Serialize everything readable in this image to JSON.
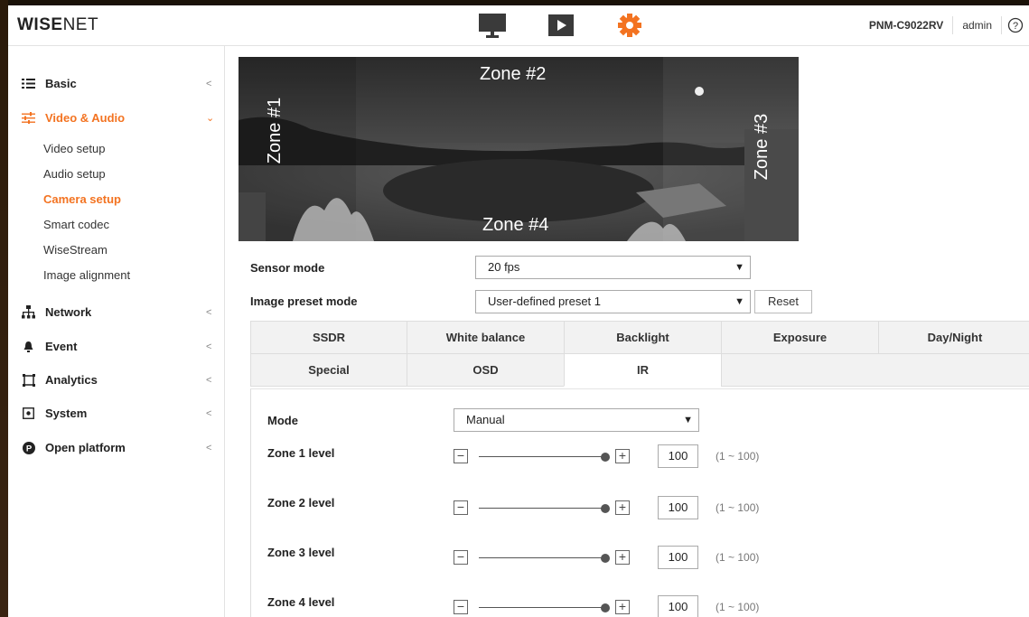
{
  "header": {
    "logo_main": "WISE",
    "logo_tail": "NET",
    "model": "PNM-C9022RV",
    "user": "admin",
    "icons": [
      "monitor-icon",
      "play-icon",
      "gear-icon"
    ],
    "active_color": "#f37321"
  },
  "sidebar": {
    "menus": [
      {
        "label": "Basic",
        "icon": "list-icon"
      },
      {
        "label": "Video & Audio",
        "icon": "sliders-icon"
      },
      {
        "label": "Network",
        "icon": "network-icon"
      },
      {
        "label": "Event",
        "icon": "bell-icon"
      },
      {
        "label": "Analytics",
        "icon": "frame-icon"
      },
      {
        "label": "System",
        "icon": "system-icon"
      },
      {
        "label": "Open platform",
        "icon": "platform-icon"
      }
    ],
    "subitems": [
      "Video setup",
      "Audio setup",
      "Camera setup",
      "Smart codec",
      "WiseStream",
      "Image alignment"
    ],
    "active_menu": "Video & Audio",
    "active_sub": "Camera setup"
  },
  "preview": {
    "zones": [
      "Zone #1",
      "Zone #2",
      "Zone #3",
      "Zone #4"
    ]
  },
  "form": {
    "sensor_mode_label": "Sensor mode",
    "sensor_mode_value": "20 fps",
    "preset_label": "Image preset mode",
    "preset_value": "User-defined preset 1",
    "reset_label": "Reset"
  },
  "tabs": {
    "row1": [
      "SSDR",
      "White balance",
      "Backlight",
      "Exposure",
      "Day/Night"
    ],
    "row2": [
      "Special",
      "OSD",
      "IR"
    ],
    "active": "IR"
  },
  "ir": {
    "mode_label": "Mode",
    "mode_value": "Manual",
    "zones": [
      {
        "label": "Zone 1 level",
        "value": "100",
        "range": "(1 ~ 100)",
        "level": 1.0
      },
      {
        "label": "Zone 2 level",
        "value": "100",
        "range": "(1 ~ 100)",
        "level": 1.0
      },
      {
        "label": "Zone 3 level",
        "value": "100",
        "range": "(1 ~ 100)",
        "level": 1.0
      },
      {
        "label": "Zone 4 level",
        "value": "100",
        "range": "(1 ~ 100)",
        "level": 1.0
      }
    ]
  }
}
